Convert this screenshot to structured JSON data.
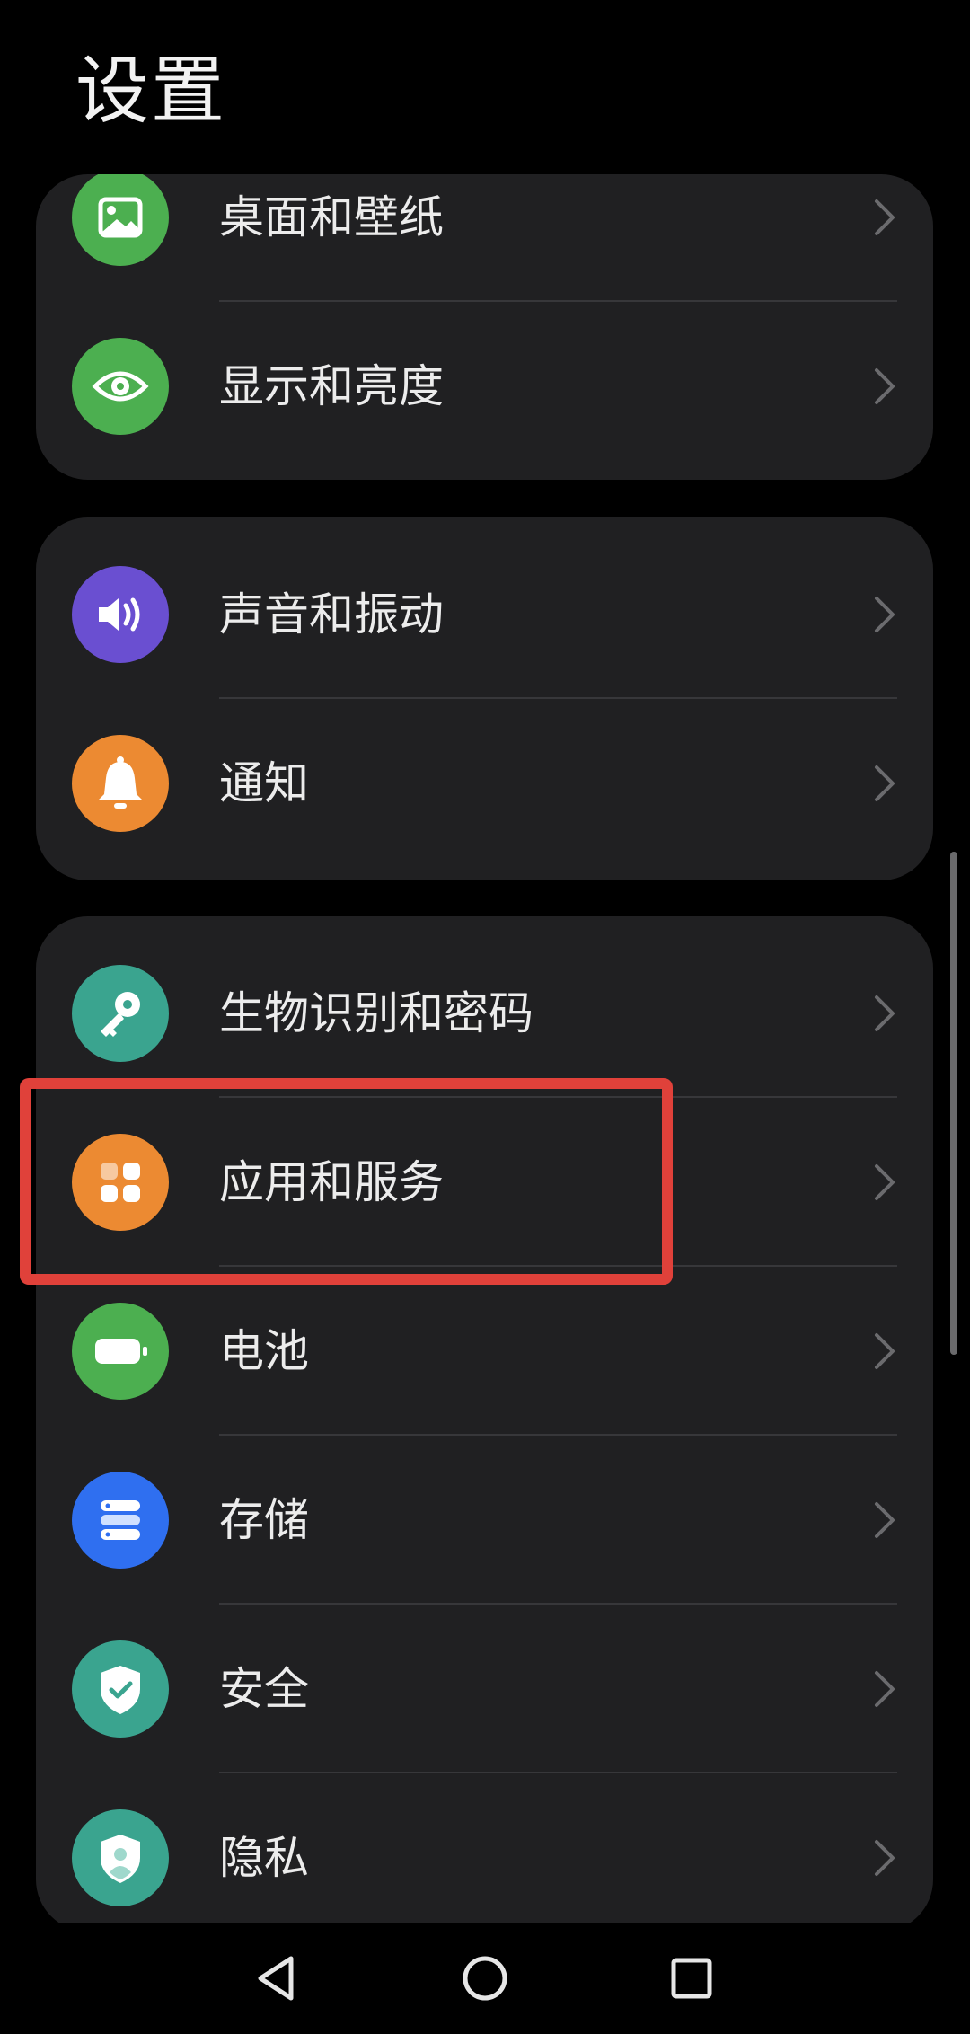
{
  "header": {
    "title": "设置"
  },
  "groups": [
    {
      "items": [
        {
          "label": "桌面和壁纸",
          "icon": "wallpaper-icon",
          "icon_color": "#4caf50"
        },
        {
          "label": "显示和亮度",
          "icon": "eye-icon",
          "icon_color": "#4caf50"
        }
      ]
    },
    {
      "items": [
        {
          "label": "声音和振动",
          "icon": "speaker-icon",
          "icon_color": "#6a4fd1"
        },
        {
          "label": "通知",
          "icon": "bell-icon",
          "icon_color": "#ec8a32"
        }
      ]
    },
    {
      "items": [
        {
          "label": "生物识别和密码",
          "icon": "key-icon",
          "icon_color": "#3aa48f"
        },
        {
          "label": "应用和服务",
          "icon": "apps-grid-icon",
          "icon_color": "#ec8a32",
          "highlighted": true
        },
        {
          "label": "电池",
          "icon": "battery-icon",
          "icon_color": "#4caf50"
        },
        {
          "label": "存储",
          "icon": "storage-icon",
          "icon_color": "#2f6ff0"
        },
        {
          "label": "安全",
          "icon": "shield-check-icon",
          "icon_color": "#3aa48f"
        },
        {
          "label": "隐私",
          "icon": "privacy-shield-icon",
          "icon_color": "#3aa48f"
        }
      ]
    }
  ],
  "highlight_color": "#e0413a",
  "nav_bar": {
    "buttons": [
      "back-triangle-icon",
      "home-circle-icon",
      "recents-square-icon"
    ]
  }
}
